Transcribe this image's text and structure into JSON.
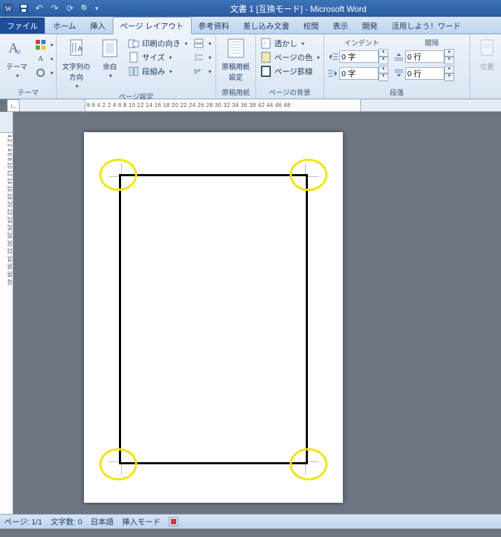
{
  "title": "文書 1 [互換モード] - Microsoft Word",
  "qat": {
    "save": "save-icon",
    "undo": "undo-icon",
    "redo": "redo-icon",
    "sync": "sync-icon",
    "down": "▾"
  },
  "tabs": {
    "file": "ファイル",
    "home": "ホーム",
    "insert": "挿入",
    "pagelayout": "ページ レイアウト",
    "references": "参考資料",
    "mailings": "差し込み文書",
    "review": "校閲",
    "view": "表示",
    "developer": "開発",
    "addin": "活用しよう！ワード"
  },
  "ribbon": {
    "themes": {
      "title": "テーマ",
      "themes_label": "テーマ",
      "colors": "",
      "fonts": "",
      "effects": ""
    },
    "pagesetup": {
      "title": "ページ設定",
      "textdir": "文字列の\n方向",
      "margins": "余白",
      "orientation": "印刷の向き",
      "size": "サイズ",
      "columns": "段組み",
      "breaks": "",
      "linenumbers": "",
      "hyphen": ""
    },
    "manuscript": {
      "title": "原稿用紙",
      "button": "原稿用紙\n設定"
    },
    "pagebg": {
      "title": "ページの背景",
      "watermark": "透かし",
      "pagecolor": "ページの色",
      "pageborders": "ページ罫線"
    },
    "paragraph": {
      "title": "段落",
      "indent_label": "インデント",
      "spacing_label": "間隔",
      "indent_left_value": "0 字",
      "indent_right_value": "0 字",
      "space_before_value": "0 行",
      "space_after_value": "0 行"
    },
    "arrange": {
      "title": "",
      "position": "位置"
    }
  },
  "rulers": {
    "h_numbers": "8  6  4  2      2  4  6  8  10 12 14 16 18 20 22 24 26 28 30 32 34 36 38    42 44 46 48",
    "v_numbers": "4  2    2  4  6  8  10 12 14 16 18 20 22 24 26 28 30 32 34 36 38 40",
    "tabchar": "∟"
  },
  "status": {
    "page": "ページ: 1/1",
    "words": "文字数: 0",
    "lang": "日本語",
    "mode": "挿入モード"
  }
}
